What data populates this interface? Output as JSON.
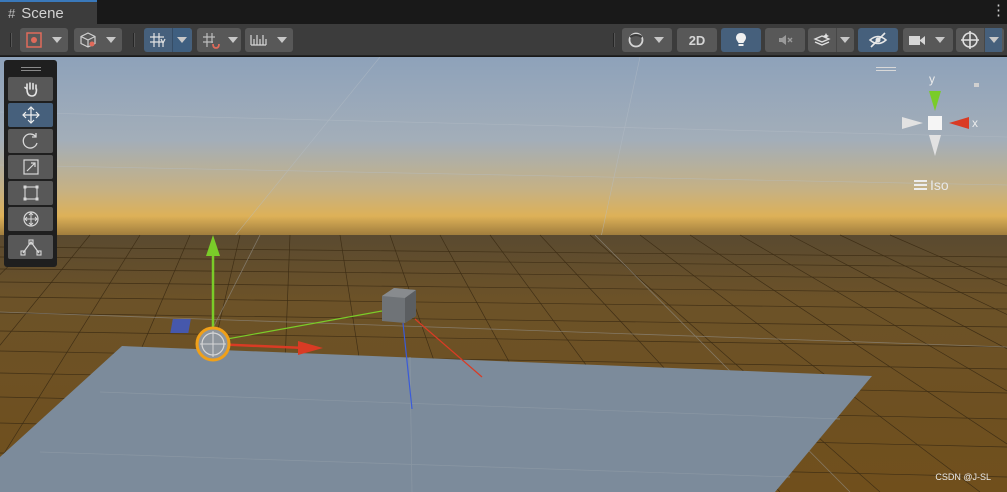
{
  "tab": {
    "title": "Scene",
    "icon": "grid-hash-icon"
  },
  "toolbar": {
    "left": [
      {
        "name": "draw-mode",
        "icon": "draw-mode-icon"
      },
      {
        "name": "shading-mode",
        "icon": "cube-icon"
      },
      {
        "name": "grid-snapping",
        "icon": "grid-snap-icon"
      },
      {
        "name": "increment-snap",
        "icon": "magnet-grid-icon"
      },
      {
        "name": "ruler",
        "icon": "ruler-icon"
      }
    ],
    "right": [
      {
        "name": "orientation",
        "icon": "orientation-icon"
      },
      {
        "name": "toggle-2d",
        "label": "2D"
      },
      {
        "name": "lighting",
        "icon": "lightbulb-icon"
      },
      {
        "name": "audio",
        "icon": "audio-mute-icon"
      },
      {
        "name": "effects",
        "icon": "effects-icon"
      },
      {
        "name": "visibility",
        "icon": "hidden-eye-icon"
      },
      {
        "name": "camera",
        "icon": "camera-icon"
      },
      {
        "name": "gizmos",
        "icon": "gizmo-globe-icon"
      }
    ]
  },
  "tools": [
    {
      "name": "hand-tool",
      "icon": "hand-icon"
    },
    {
      "name": "move-tool",
      "icon": "move-arrows-icon",
      "selected": true
    },
    {
      "name": "rotate-tool",
      "icon": "rotate-icon"
    },
    {
      "name": "scale-tool",
      "icon": "scale-icon"
    },
    {
      "name": "rect-tool",
      "icon": "rect-icon"
    },
    {
      "name": "transform-tool",
      "icon": "transform-icon"
    },
    {
      "name": "custom-tool",
      "icon": "custom-tool-icon"
    }
  ],
  "gizmo": {
    "x_label": "x",
    "y_label": "y",
    "projection": "Iso"
  },
  "watermark": "CSDN @J-SL",
  "colors": {
    "x_axis": "#d93b24",
    "y_axis": "#7acc29",
    "z_axis": "#3a5bd9",
    "selected_tool": "#46607c",
    "tab_accent": "#3a79bb"
  }
}
